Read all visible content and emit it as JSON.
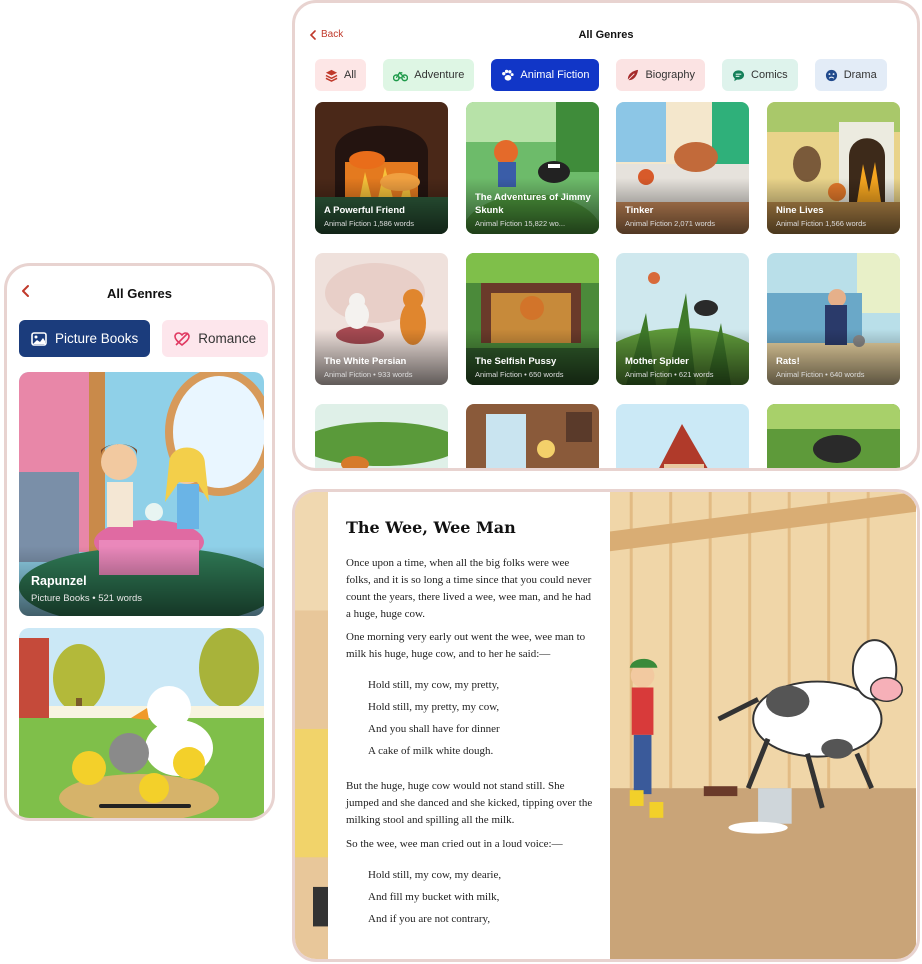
{
  "phone": {
    "title": "All Genres",
    "tabs": [
      {
        "label": "Picture Books",
        "icon": "image-icon",
        "active": true
      },
      {
        "label": "Romance",
        "icon": "heart-arrow-icon",
        "active": false
      }
    ],
    "books": [
      {
        "title": "Rapunzel",
        "meta": "Picture Books • 521 words"
      },
      {
        "title": "",
        "meta": ""
      }
    ]
  },
  "tablet": {
    "back_label": "Back",
    "title": "All Genres",
    "genres": [
      {
        "label": "All",
        "icon": "layers-icon",
        "bg": "#fde6e6",
        "fg": "#c0392b"
      },
      {
        "label": "Adventure",
        "icon": "bike-icon",
        "bg": "#def6e4",
        "fg": "#1f9a4a"
      },
      {
        "label": "Animal Fiction",
        "icon": "paw-icon",
        "bg": "#1136c7",
        "fg": "#ffffff",
        "active": true
      },
      {
        "label": "Biography",
        "icon": "feather-icon",
        "bg": "#fbe3e3",
        "fg": "#a52a2a"
      },
      {
        "label": "Comics",
        "icon": "speech-bubble-icon",
        "bg": "#def3ec",
        "fg": "#15805a"
      },
      {
        "label": "Drama",
        "icon": "mask-icon",
        "bg": "#e3ecf7",
        "fg": "#214a8c"
      }
    ],
    "books": [
      {
        "title": "A Powerful Friend",
        "meta": "Animal Fiction   1,586 words"
      },
      {
        "title": "The Adventures of Jimmy Skunk",
        "meta": "Animal Fiction   15,822 wo..."
      },
      {
        "title": "Tinker",
        "meta": "Animal Fiction   2,071 words"
      },
      {
        "title": "Nine Lives",
        "meta": "Animal Fiction   1,566 words"
      },
      {
        "title": "The White Persian",
        "meta": "Animal Fiction • 933 words"
      },
      {
        "title": "The Selfish Pussy",
        "meta": "Animal Fiction • 650 words"
      },
      {
        "title": "Mother Spider",
        "meta": "Animal Fiction • 621 words"
      },
      {
        "title": "Rats!",
        "meta": "Animal Fiction • 640 words"
      },
      {
        "title": "",
        "meta": ""
      },
      {
        "title": "",
        "meta": ""
      },
      {
        "title": "",
        "meta": ""
      },
      {
        "title": "",
        "meta": ""
      }
    ]
  },
  "reader": {
    "title": "The Wee, Wee Man",
    "p1": "Once upon a time, when all the big folks were wee folks, and it is so long a time since that you could never count the years, there lived a wee, wee man, and he had a huge, huge cow.",
    "p2": "One morning very early out went the wee, wee man to milk his huge, huge cow, and to her he said:—",
    "verse1": [
      "Hold still, my cow, my pretty,",
      "Hold still, my pretty, my cow,",
      "And you shall have for dinner",
      "A cake of milk white dough."
    ],
    "p3": "But the huge, huge cow would not stand still. She jumped and she danced and she kicked, tipping over the milking stool and spilling all the milk.",
    "p4": "So the wee, wee man cried out in a loud voice:—",
    "verse2": [
      "Hold still, my cow, my dearie,",
      "And fill my bucket with milk,",
      "And if you are not contrary,"
    ]
  }
}
